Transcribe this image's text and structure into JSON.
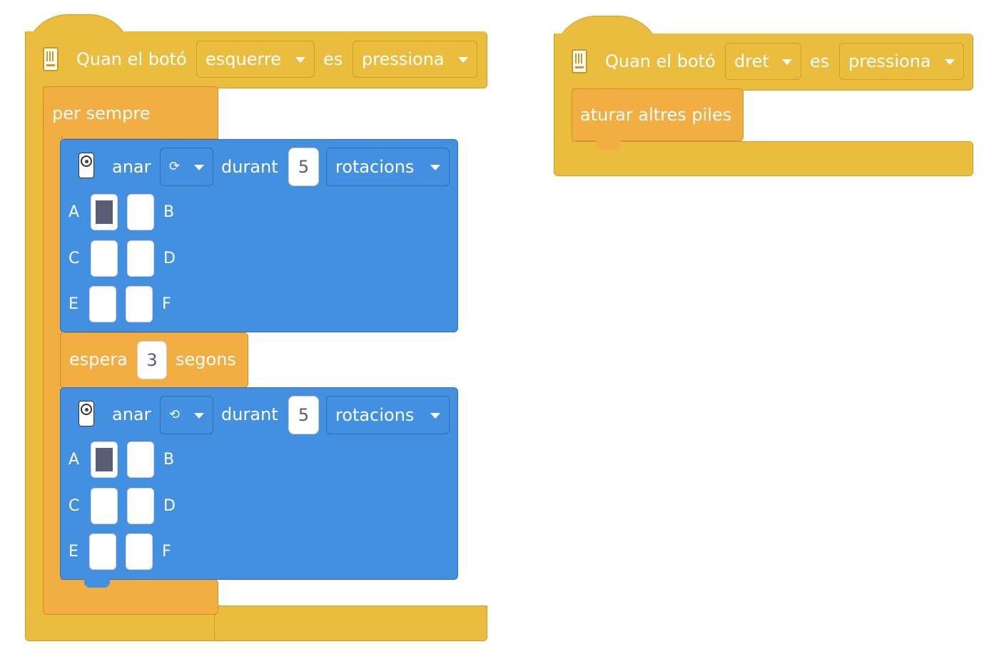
{
  "stack1": {
    "hat": {
      "label": "Quan el botó",
      "button_value": "esquerre",
      "es_label": "es",
      "action_value": "pressiona",
      "icon": "hub-brick-icon"
    },
    "forever_label": "per sempre",
    "motor1": {
      "go_label": "anar",
      "direction_glyph": "⟳",
      "for_label": "durant",
      "amount": "5",
      "unit_value": "rotacions",
      "icon": "motor-icon",
      "ports": [
        {
          "label": "A",
          "selected": true
        },
        {
          "label": "B",
          "selected": false
        },
        {
          "label": "C",
          "selected": false
        },
        {
          "label": "D",
          "selected": false
        },
        {
          "label": "E",
          "selected": false
        },
        {
          "label": "F",
          "selected": false
        }
      ]
    },
    "wait": {
      "label": "espera",
      "amount": "3",
      "unit_label": "segons"
    },
    "motor2": {
      "go_label": "anar",
      "direction_glyph": "⟲",
      "for_label": "durant",
      "amount": "5",
      "unit_value": "rotacions",
      "icon": "motor-icon",
      "ports": [
        {
          "label": "A",
          "selected": true
        },
        {
          "label": "B",
          "selected": false
        },
        {
          "label": "C",
          "selected": false
        },
        {
          "label": "D",
          "selected": false
        },
        {
          "label": "E",
          "selected": false
        },
        {
          "label": "F",
          "selected": false
        }
      ]
    }
  },
  "stack2": {
    "hat": {
      "label": "Quan el botó",
      "button_value": "dret",
      "es_label": "es",
      "action_value": "pressiona",
      "icon": "hub-brick-icon"
    },
    "stop_label": "aturar altres piles"
  },
  "colors": {
    "events": "#ebbd3f",
    "control": "#f2ae42",
    "motors": "#4290df",
    "port_selected": "#575e75"
  }
}
